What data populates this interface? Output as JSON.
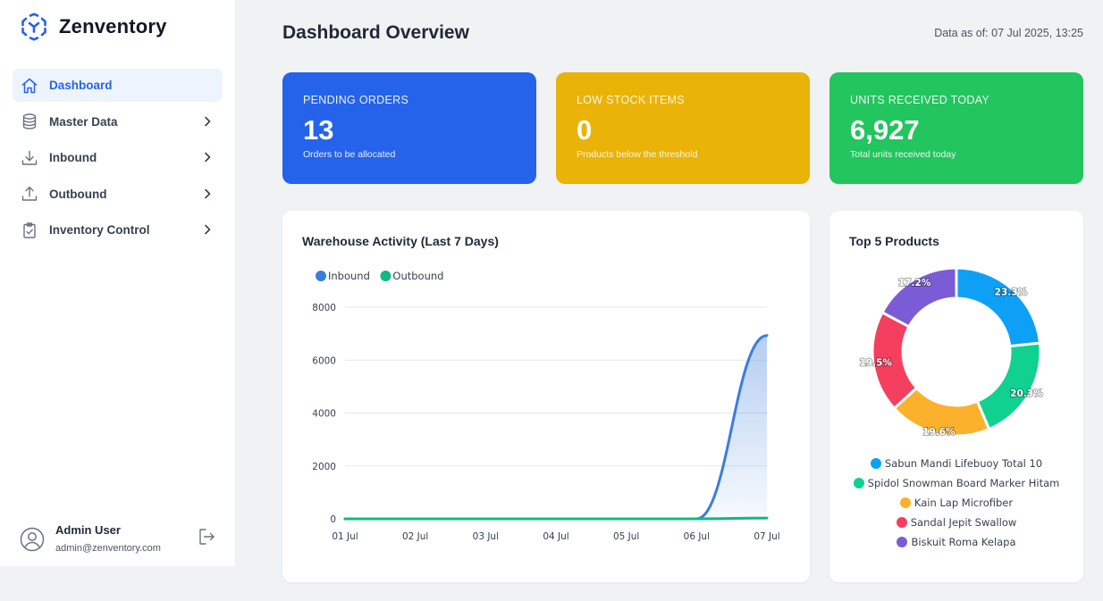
{
  "app": {
    "name": "Zenventory"
  },
  "sidebar": {
    "items": [
      {
        "label": "Dashboard",
        "icon": "home-icon",
        "active": true,
        "has_children": false
      },
      {
        "label": "Master Data",
        "icon": "database-icon",
        "active": false,
        "has_children": true
      },
      {
        "label": "Inbound",
        "icon": "download-icon",
        "active": false,
        "has_children": true
      },
      {
        "label": "Outbound",
        "icon": "upload-icon",
        "active": false,
        "has_children": true
      },
      {
        "label": "Inventory Control",
        "icon": "clipboard-check-icon",
        "active": false,
        "has_children": true
      }
    ]
  },
  "user": {
    "name": "Admin User",
    "email": "admin@zenventory.com"
  },
  "header": {
    "title": "Dashboard Overview",
    "timestamp": "Data as of: 07 Jul 2025, 13:25"
  },
  "stats": [
    {
      "label": "PENDING ORDERS",
      "value": "13",
      "sub": "Orders to be allocated",
      "color": "#2563eb"
    },
    {
      "label": "LOW STOCK ITEMS",
      "value": "0",
      "sub": "Products below the threshold",
      "color": "#eab308"
    },
    {
      "label": "UNITS RECEIVED TODAY",
      "value": "6,927",
      "sub": "Total units received today",
      "color": "#22c55e"
    }
  ],
  "activity_card": {
    "title": "Warehouse Activity (Last 7 Days)"
  },
  "products_card": {
    "title": "Top 5 Products"
  },
  "chart_data": [
    {
      "type": "area",
      "title": "Warehouse Activity (Last 7 Days)",
      "categories": [
        "01 Jul",
        "02 Jul",
        "03 Jul",
        "04 Jul",
        "05 Jul",
        "06 Jul",
        "07 Jul"
      ],
      "ylim": [
        0,
        8000
      ],
      "yticks": [
        0,
        2000,
        4000,
        6000,
        8000
      ],
      "grid": true,
      "legend_position": "top-left",
      "series": [
        {
          "name": "Inbound",
          "values": [
            0,
            0,
            0,
            0,
            0,
            0,
            6927
          ],
          "color": "#3b7ddd",
          "fill": true
        },
        {
          "name": "Outbound",
          "values": [
            0,
            0,
            0,
            0,
            0,
            0,
            30
          ],
          "color": "#10b981",
          "fill": false
        }
      ]
    },
    {
      "type": "pie",
      "title": "Top 5 Products",
      "legend_position": "bottom",
      "slices": [
        {
          "label": "Sabun Mandi Lifebuoy Total 10",
          "value": 23.3,
          "display": "23.3%",
          "color": "#0ea0f5"
        },
        {
          "label": "Spidol Snowman Board Marker Hitam",
          "value": 20.3,
          "display": "20.3%",
          "color": "#10d190"
        },
        {
          "label": "Kain Lap Microfiber",
          "value": 19.6,
          "display": "19.6%",
          "color": "#fbb12c"
        },
        {
          "label": "Sandal Jepit Swallow",
          "value": 19.5,
          "display": "19.5%",
          "color": "#f43f5e"
        },
        {
          "label": "Biskuit Roma Kelapa",
          "value": 17.2,
          "display": "17.2%",
          "color": "#7c5cd6"
        }
      ]
    }
  ]
}
